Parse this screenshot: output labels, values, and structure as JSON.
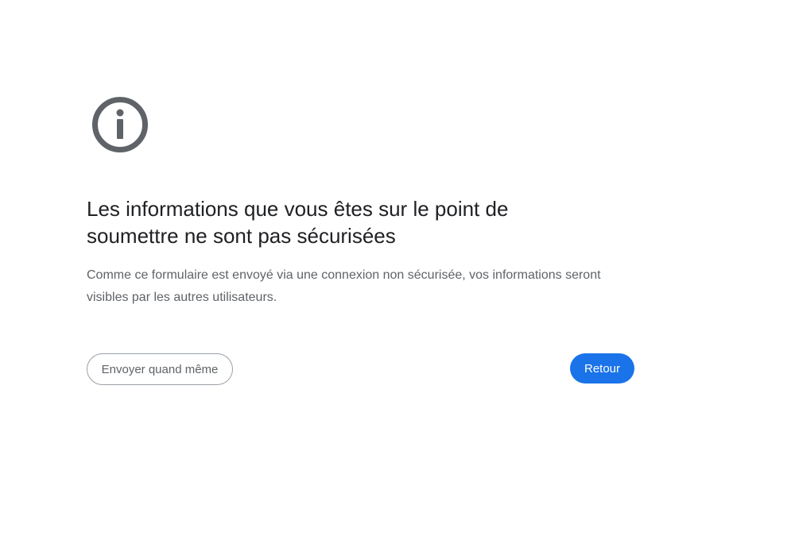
{
  "icon": "info-circle-icon",
  "heading": "Les informations que vous êtes sur le point de soumettre ne sont pas sécurisées",
  "description": "Comme ce formulaire est envoyé via une connexion non sécurisée, vos informations seront visibles par les autres utilisateurs.",
  "buttons": {
    "send_anyway": "Envoyer quand même",
    "back": "Retour"
  },
  "colors": {
    "accent": "#1a73e8",
    "icon": "#5f6368",
    "heading": "#202124",
    "text": "#5f6368"
  }
}
